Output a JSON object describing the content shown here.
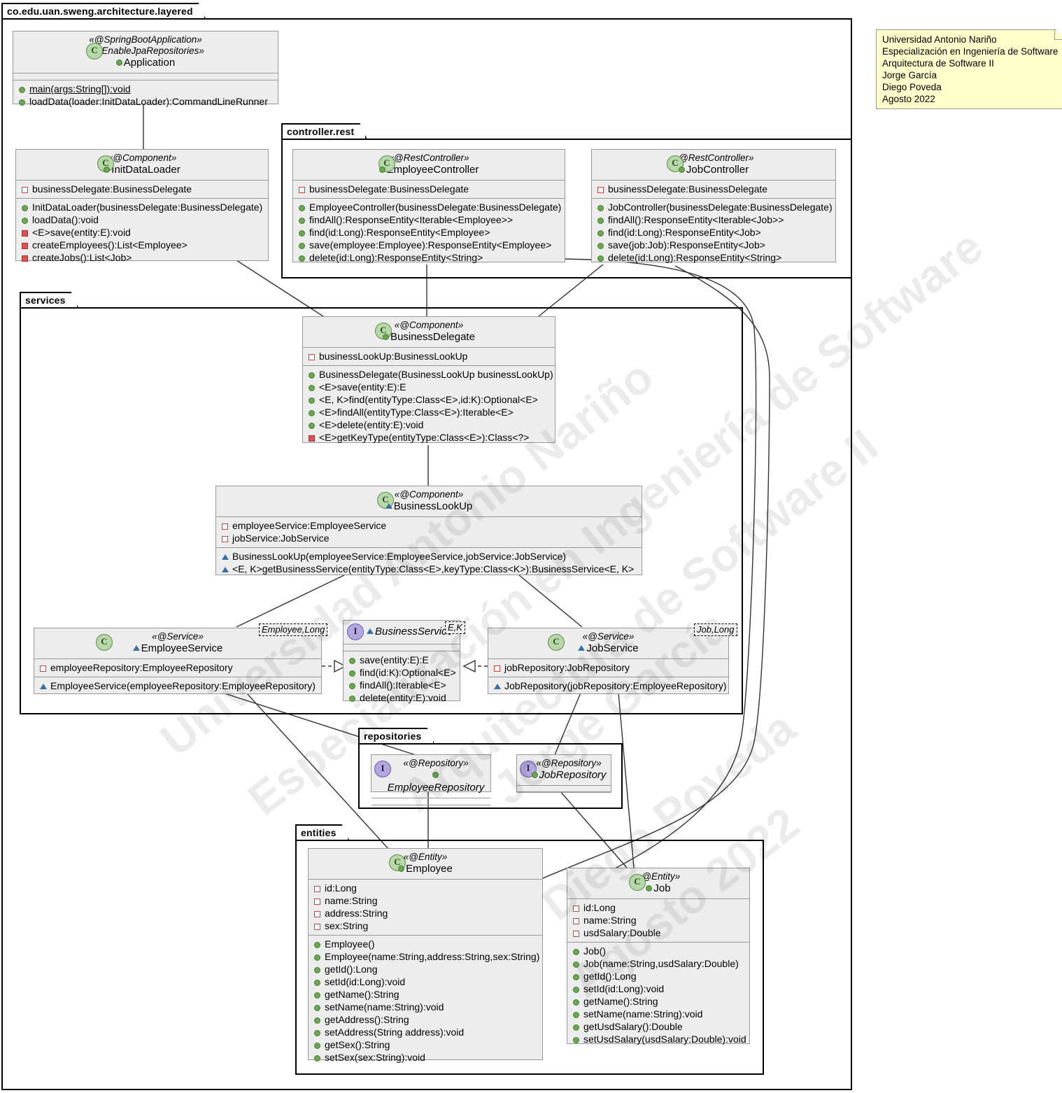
{
  "root_package": {
    "label": "co.edu.uan.sweng.architecture.layered"
  },
  "packages": [
    {
      "name": "controller-rest",
      "label": "controller.rest"
    },
    {
      "name": "services",
      "label": "services"
    },
    {
      "name": "repositories",
      "label": "repositories"
    },
    {
      "name": "entities",
      "label": "entities"
    }
  ],
  "note": {
    "lines": [
      "Universidad Antonio Nariño",
      "Especialización en Ingeniería de Software",
      "Arquitectura de Software II",
      "Jorge García",
      "Diego Poveda",
      "Agosto 2022"
    ]
  },
  "watermark": {
    "lines": [
      "Universidad Antonio Nariño",
      "Especialización en Ingeniería de Software",
      "Arquitectura de Software II",
      "Jorge García",
      "Diego Poveda",
      "Agosto 2022"
    ]
  },
  "classes": {
    "application": {
      "stereotypes": [
        "«@SpringBootApplication»",
        "«@EnableJpaRepositories»"
      ],
      "name": "Application",
      "kind": "class",
      "name_visibility": "public",
      "attributes": [],
      "operations": [
        {
          "text": "main(args:String[]):void",
          "visibility": "public",
          "static": true
        },
        {
          "text": "loadData(loader:InitDataLoader):CommandLineRunner",
          "visibility": "public",
          "static": false
        }
      ]
    },
    "init_data_loader": {
      "stereotypes": [
        "«@Component»"
      ],
      "name": "InitDataLoader",
      "kind": "class",
      "name_visibility": "public",
      "attributes": [
        {
          "text": "businessDelegate:BusinessDelegate",
          "visibility": "private-field"
        }
      ],
      "operations": [
        {
          "text": "InitDataLoader(businessDelegate:BusinessDelegate)",
          "visibility": "public"
        },
        {
          "text": "loadData():void",
          "visibility": "public"
        },
        {
          "text": "<E>save(entity:E):void",
          "visibility": "private"
        },
        {
          "text": "createEmployees():List<Employee>",
          "visibility": "private"
        },
        {
          "text": "createJobs():List<Job>",
          "visibility": "private"
        }
      ]
    },
    "employee_controller": {
      "stereotypes": [
        "«@RestController»"
      ],
      "name": "EmployeeController",
      "kind": "class",
      "name_visibility": "public",
      "attributes": [
        {
          "text": "businessDelegate:BusinessDelegate",
          "visibility": "private-field"
        }
      ],
      "operations": [
        {
          "text": "EmployeeController(businessDelegate:BusinessDelegate)",
          "visibility": "public"
        },
        {
          "text": "findAll():ResponseEntity<Iterable<Employee>>",
          "visibility": "public"
        },
        {
          "text": "find(id:Long):ResponseEntity<Employee>",
          "visibility": "public"
        },
        {
          "text": "save(employee:Employee):ResponseEntity<Employee>",
          "visibility": "public"
        },
        {
          "text": "delete(id:Long):ResponseEntity<String>",
          "visibility": "public"
        }
      ]
    },
    "job_controller": {
      "stereotypes": [
        "«@RestController»"
      ],
      "name": "JobController",
      "kind": "class",
      "name_visibility": "public",
      "attributes": [
        {
          "text": "businessDelegate:BusinessDelegate",
          "visibility": "private-field"
        }
      ],
      "operations": [
        {
          "text": "JobController(businessDelegate:BusinessDelegate)",
          "visibility": "public"
        },
        {
          "text": "findAll():ResponseEntity<Iterable<Job>>",
          "visibility": "public"
        },
        {
          "text": "find(id:Long):ResponseEntity<Job>",
          "visibility": "public"
        },
        {
          "text": "save(job:Job):ResponseEntity<Job>",
          "visibility": "public"
        },
        {
          "text": "delete(id:Long):ResponseEntity<String>",
          "visibility": "public"
        }
      ]
    },
    "business_delegate": {
      "stereotypes": [
        "«@Component»"
      ],
      "name": "BusinessDelegate",
      "kind": "class",
      "name_visibility": "public",
      "attributes": [
        {
          "text": "businessLookUp:BusinessLookUp",
          "visibility": "private-field"
        }
      ],
      "operations": [
        {
          "text": "BusinessDelegate(BusinessLookUp businessLookUp)",
          "visibility": "public"
        },
        {
          "text": "<E>save(entity:E):E",
          "visibility": "public"
        },
        {
          "text": "<E, K>find(entityType:Class<E>,id:K):Optional<E>",
          "visibility": "public"
        },
        {
          "text": "<E>findAll(entityType:Class<E>):Iterable<E>",
          "visibility": "public"
        },
        {
          "text": "<E>delete(entity:E):void",
          "visibility": "public"
        },
        {
          "text": "<E>getKeyType(entityType:Class<E>):Class<?>",
          "visibility": "private"
        }
      ]
    },
    "business_lookup": {
      "stereotypes": [
        "«@Component»"
      ],
      "name": "BusinessLookUp",
      "kind": "class",
      "name_visibility": "package",
      "attributes": [
        {
          "text": "employeeService:EmployeeService",
          "visibility": "private-field"
        },
        {
          "text": "jobService:JobService",
          "visibility": "private-field"
        }
      ],
      "operations": [
        {
          "text": "BusinessLookUp(employeeService:EmployeeService,jobService:JobService)",
          "visibility": "package"
        },
        {
          "text": "<E, K>getBusinessService(entityType:Class<E>,keyType:Class<K>):BusinessService<E, K>",
          "visibility": "package"
        }
      ]
    },
    "employee_service": {
      "stereotypes": [
        "«@Service»"
      ],
      "name": "EmployeeService",
      "kind": "class",
      "name_visibility": "package",
      "template": "Employee,Long",
      "attributes": [
        {
          "text": "employeeRepository:EmployeeRepository",
          "visibility": "private-field"
        }
      ],
      "operations": [
        {
          "text": "EmployeeService(employeeRepository:EmployeeRepository)",
          "visibility": "package"
        }
      ]
    },
    "business_service": {
      "stereotypes": [],
      "name": "BusinessService",
      "kind": "interface",
      "name_visibility": "package",
      "template": "E,K",
      "attributes": [],
      "operations": [
        {
          "text": "save(entity:E):E",
          "visibility": "public"
        },
        {
          "text": "find(id:K):Optional<E>",
          "visibility": "public"
        },
        {
          "text": "findAll():Iterable<E>",
          "visibility": "public"
        },
        {
          "text": "delete(entity:E):void",
          "visibility": "public"
        }
      ]
    },
    "job_service": {
      "stereotypes": [
        "«@Service»"
      ],
      "name": "JobService",
      "kind": "class",
      "name_visibility": "package",
      "template": "Job,Long",
      "attributes": [
        {
          "text": "jobRepository:JobRepository",
          "visibility": "private-field"
        }
      ],
      "operations": [
        {
          "text": "JobRepository(jobRepository:EmployeeRepository)",
          "visibility": "package"
        }
      ]
    },
    "employee_repository": {
      "stereotypes": [
        "«@Repository»"
      ],
      "name": "EmployeeRepository",
      "kind": "interface",
      "name_visibility": "public",
      "attributes": [],
      "operations": []
    },
    "job_repository": {
      "stereotypes": [
        "«@Repository»"
      ],
      "name": "JobRepository",
      "kind": "interface",
      "name_visibility": "public",
      "attributes": [],
      "operations": []
    },
    "employee": {
      "stereotypes": [
        "«@Entity»"
      ],
      "name": "Employee",
      "kind": "class",
      "name_visibility": "public",
      "attributes": [
        {
          "text": "id:Long",
          "visibility": "private-field"
        },
        {
          "text": "name:String",
          "visibility": "private-field"
        },
        {
          "text": "address:String",
          "visibility": "private-field"
        },
        {
          "text": "sex:String",
          "visibility": "private-field"
        }
      ],
      "operations": [
        {
          "text": "Employee()",
          "visibility": "public"
        },
        {
          "text": "Employee(name:String,address:String,sex:String)",
          "visibility": "public"
        },
        {
          "text": "getId():Long",
          "visibility": "public"
        },
        {
          "text": "setId(id:Long):void",
          "visibility": "public"
        },
        {
          "text": "getName():String",
          "visibility": "public"
        },
        {
          "text": "setName(name:String):void",
          "visibility": "public"
        },
        {
          "text": "getAddress():String",
          "visibility": "public"
        },
        {
          "text": "setAddress(String address):void",
          "visibility": "public"
        },
        {
          "text": "getSex():String",
          "visibility": "public"
        },
        {
          "text": "setSex(sex:String):void",
          "visibility": "public"
        }
      ]
    },
    "job": {
      "stereotypes": [
        "«@Entity»"
      ],
      "name": "Job",
      "kind": "class",
      "name_visibility": "public",
      "attributes": [
        {
          "text": "id:Long",
          "visibility": "private-field"
        },
        {
          "text": "name:String",
          "visibility": "private-field"
        },
        {
          "text": "usdSalary:Double",
          "visibility": "private-field"
        }
      ],
      "operations": [
        {
          "text": "Job()",
          "visibility": "public"
        },
        {
          "text": "Job(name:String,usdSalary:Double)",
          "visibility": "public"
        },
        {
          "text": "getId():Long",
          "visibility": "public"
        },
        {
          "text": "setId(id:Long):void",
          "visibility": "public"
        },
        {
          "text": "getName():String",
          "visibility": "public"
        },
        {
          "text": "setName(name:String):void",
          "visibility": "public"
        },
        {
          "text": "getUsdSalary():Double",
          "visibility": "public"
        },
        {
          "text": "setUsdSalary(usdSalary:Double):void",
          "visibility": "public"
        }
      ]
    }
  },
  "icons": {
    "class_glyph": "C",
    "interface_glyph": "I"
  },
  "colors": {
    "class_fill": "#ededed",
    "class_border": "#999999",
    "note_fill": "#ffffcc",
    "class_icon": "#b6d7a8",
    "interface_icon": "#b4a7e0",
    "public_marker": "#6aa84f",
    "private_marker": "#e05050",
    "package_marker": "#3a6ea5"
  }
}
